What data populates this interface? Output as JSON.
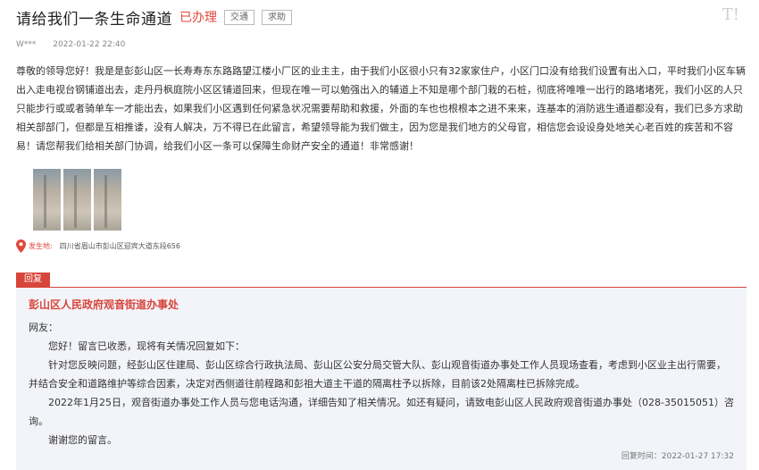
{
  "header": {
    "title": "请给我们一条生命通道",
    "status": "已办理",
    "tags": [
      "交通",
      "求助"
    ],
    "logo_text": "T!"
  },
  "meta": {
    "author": "W***",
    "date": "2022-01-22 22:40"
  },
  "message": {
    "text": "尊敬的领导您好！我是是彭彭山区一长寿寿东东路路望江楼小厂区的业主主，由于我们小区很小只有32家家住户，小区门口没有给我们设置有出入口，平时我们小区车辆出入走电视台钢铺道出去，走丹丹枫庭院小区区铺道回来，但现在唯一可以勉强出入的辅道上不知是哪个部门栽的石桩，彻底将唯唯一出行的路堵堵死，我们小区的人只只能步行或或者骑单车一才能出去，如果我们小区遇到任何紧急状况需要帮助和救援，外面的车也也根根本之进不来来，连基本的消防逃生通道都没有，我们已多方求助相关部部门，但都是互相推诿，没有人解决，万不得已在此留言，希望领导能为我们做主，因为您是我们地方的父母官，相信您会设设身处地关心老百姓的疾苦和不容易！请您帮我们给相关部门协调，给我们小区一条可以保障生命财产安全的通道！非常感谢！"
  },
  "attachments": {
    "thumbnails": [
      "street-photo-1",
      "street-photo-2",
      "street-photo-3"
    ]
  },
  "location": {
    "label": "发生地:",
    "value": "四川省眉山市彭山区迎宾大道东段656"
  },
  "reply": {
    "tab_label": "回复",
    "org": "彭山区人民政府观音街道办事处",
    "salutation": "网友：",
    "paragraphs": [
      "您好！留言已收悉，现将有关情况回复如下：",
      "针对您反映问题，经彭山区住建局、彭山区综合行政执法局、彭山区公安分局交管大队、彭山观音街道办事处工作人员现场查看，考虑到小区业主出行需要，并结合安全和道路维护等综合因素，决定对西侧道往前程路和彭祖大道主干道的隔离柱予以拆除，目前该2处隔离柱已拆除完成。",
      "2022年1月25日，观音街道办事处工作人员与您电话沟通，详细告知了相关情况。如还有疑问，请致电彭山区人民政府观音街道办事处（028-35015051）咨询。",
      "谢谢您的留言。"
    ],
    "time_label": "回复时间：",
    "time": "2022-01-27 17:32"
  },
  "colors": {
    "accent": "#d8453a",
    "reply_bg": "#f3f4f9"
  }
}
